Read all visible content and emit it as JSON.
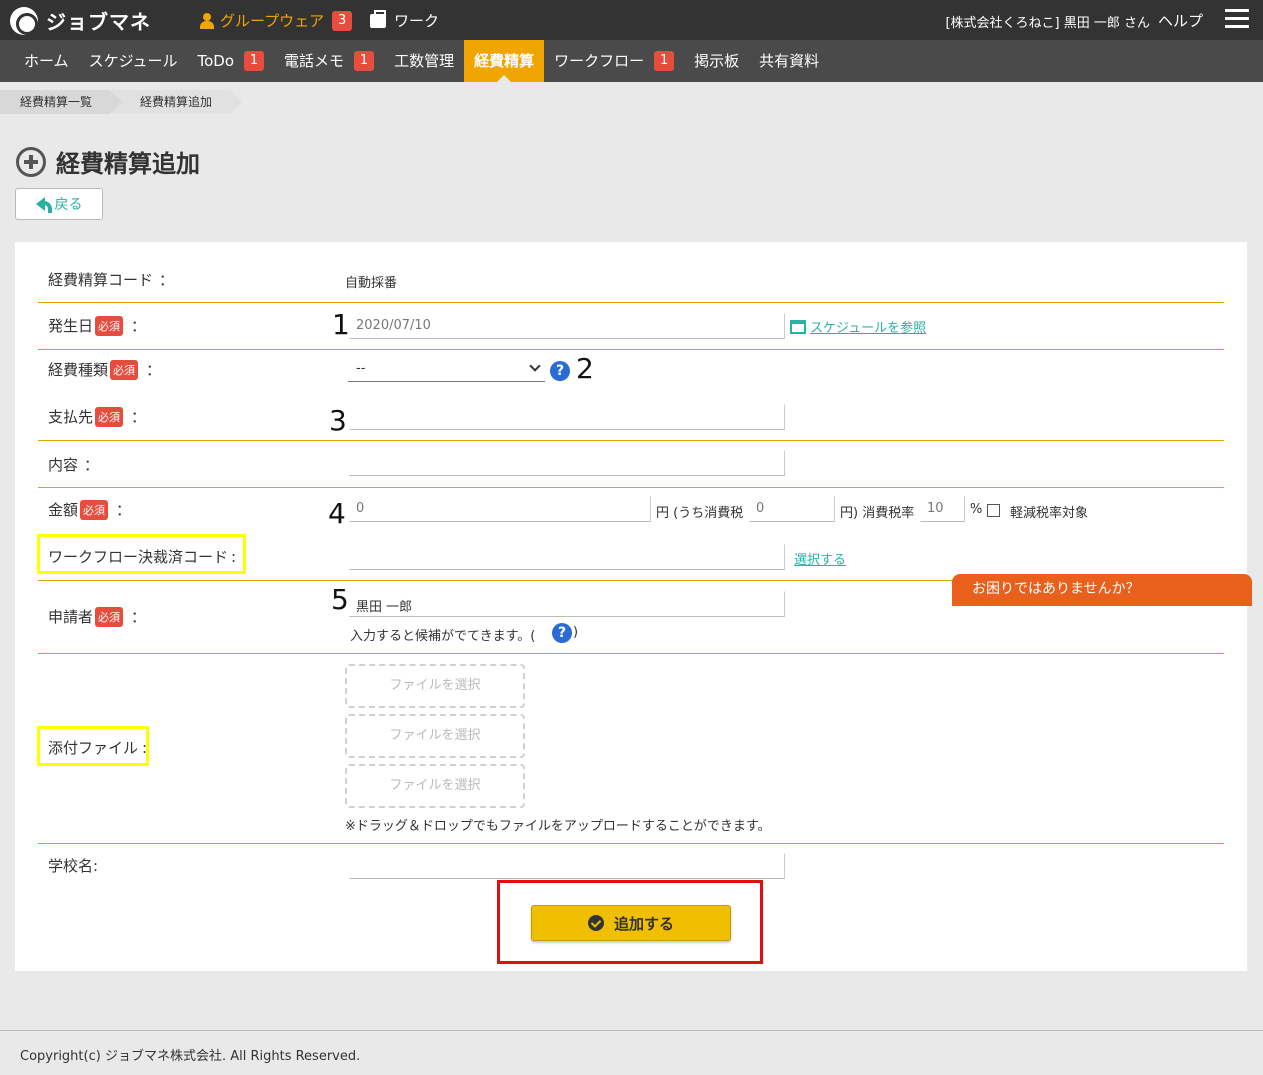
{
  "app": {
    "name": "ジョブマネ"
  },
  "topnav": {
    "groupware_label": "グループウェア",
    "groupware_badge": "3",
    "work_label": "ワーク",
    "user": "[株式会社くろねこ] 黒田 一郎 さん",
    "help": "ヘルプ"
  },
  "menu": [
    {
      "label": "ホーム"
    },
    {
      "label": "スケジュール"
    },
    {
      "label": "ToDo",
      "badge": "1"
    },
    {
      "label": "電話メモ",
      "badge": "1"
    },
    {
      "label": "工数管理"
    },
    {
      "label": "経費精算",
      "active": true
    },
    {
      "label": "ワークフロー",
      "badge": "1"
    },
    {
      "label": "掲示板"
    },
    {
      "label": "共有資料"
    }
  ],
  "breadcrumb": {
    "first": "経費精算一覧",
    "second": "経費精算追加"
  },
  "page": {
    "title": "経費精算追加",
    "back_label": "戻る"
  },
  "form": {
    "required_badge": "必須",
    "colon": "：",
    "code_label": "経費精算コード",
    "code_value": "自動採番",
    "date_label": "発生日",
    "date_value": "2020/07/10",
    "schedule_link": "スケジュールを参照",
    "type_label": "経費種類",
    "type_value": "--",
    "payee_label": "支払先",
    "payee_value": "",
    "content_label": "内容",
    "content_value": "",
    "amount_label": "金額",
    "amount_value": "0",
    "yen_tax_label": "円 (うち消費税",
    "tax_value": "0",
    "tax_rate_label": "円) 消費税率",
    "tax_rate_value": "10",
    "percent": "%",
    "reduced_label": "軽減税率対象",
    "workflow_label": "ワークフロー決裁済コード",
    "workflow_colon": ":",
    "workflow_value": "",
    "select_link": "選択する",
    "applicant_label": "申請者",
    "applicant_value": "黒田 一郎",
    "applicant_hint": "入力すると候補がでてきます。(",
    "applicant_hint_end": ")",
    "attach_label": "添付ファイル",
    "attach_colon": ":",
    "file_select": "ファイルを選択",
    "drag_note": "※ドラッグ＆ドロップでもファイルをアップロードすることができます。",
    "school_label": "学校名:",
    "school_value": "",
    "submit_label": "追加する"
  },
  "annotations": {
    "n1": "1",
    "n2": "2",
    "n3": "3",
    "n4": "4",
    "n5": "5"
  },
  "help_tab": "お困りではありませんか？",
  "footer": "Copyright(c) ジョブマネ株式会社. All Rights Reserved."
}
